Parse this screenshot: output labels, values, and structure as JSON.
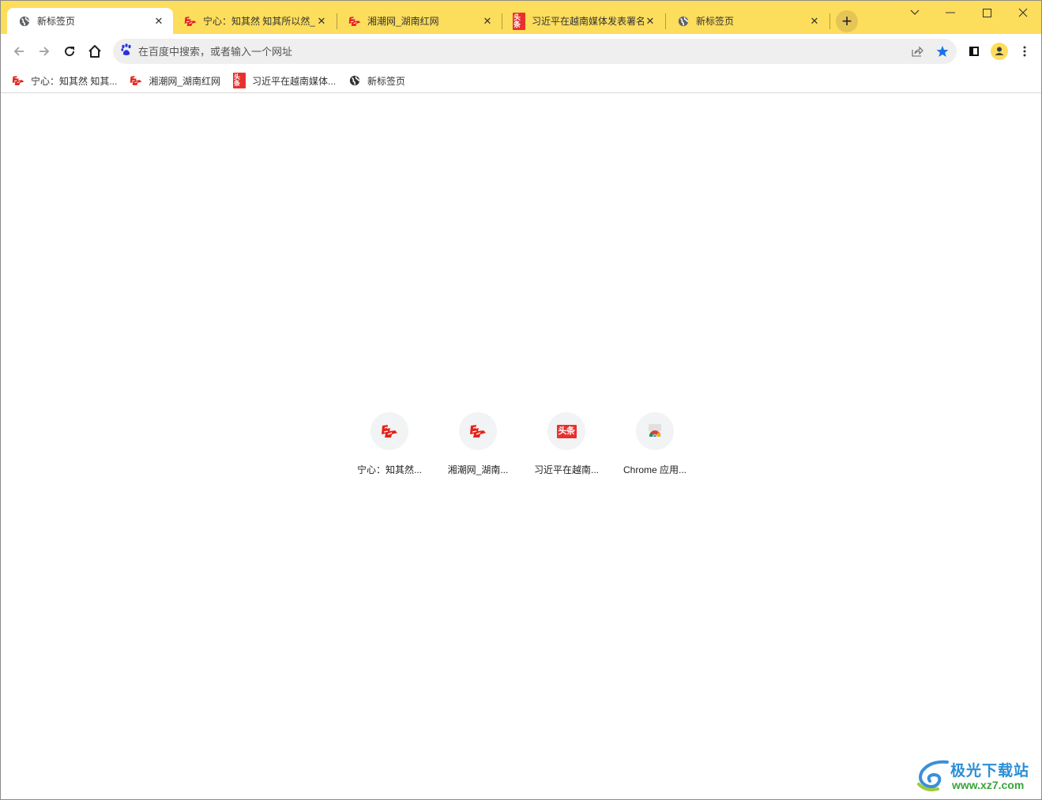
{
  "tabs": [
    {
      "title": "新标签页",
      "icon": "globe-icon",
      "active": true
    },
    {
      "title": "宁心：知其然 知其所以然_",
      "icon": "xhs-logo-icon",
      "active": false
    },
    {
      "title": "湘潮网_湖南红网",
      "icon": "xhs-logo-icon",
      "active": false
    },
    {
      "title": "习近平在越南媒体发表署名",
      "icon": "toutiao-icon",
      "active": false
    },
    {
      "title": "新标签页",
      "icon": "globe-icon",
      "active": false
    }
  ],
  "tab_close_glyph": "✕",
  "new_tab_glyph": "+",
  "window_controls": {
    "search_tabs": "﹀",
    "minimize": "—",
    "maximize": "☐",
    "close": "✕"
  },
  "omnibox": {
    "placeholder": "在百度中搜索，或者输入一个网址",
    "value": ""
  },
  "bookmarks": [
    {
      "label": "宁心：知其然 知其...",
      "icon": "xhs-logo-icon"
    },
    {
      "label": "湘潮网_湖南红网",
      "icon": "xhs-logo-icon"
    },
    {
      "label": "习近平在越南媒体...",
      "icon": "toutiao-icon"
    },
    {
      "label": "新标签页",
      "icon": "globe-icon"
    }
  ],
  "shortcuts": [
    {
      "label": "宁心：知其然...",
      "icon": "xhs-logo-icon"
    },
    {
      "label": "湘潮网_湖南...",
      "icon": "xhs-logo-icon"
    },
    {
      "label": "习近平在越南...",
      "icon": "toutiao-icon"
    },
    {
      "label": "Chrome 应用...",
      "icon": "chrome-webstore-icon"
    }
  ],
  "toutiao_text": "头条",
  "watermark": {
    "title": "极光下载站",
    "url": "www.xz7.com"
  },
  "colors": {
    "tabstrip": "#fddd5c",
    "accent_star": "#1a73e8",
    "profile": "#fddd5c",
    "brand_red": "#e8312f"
  }
}
